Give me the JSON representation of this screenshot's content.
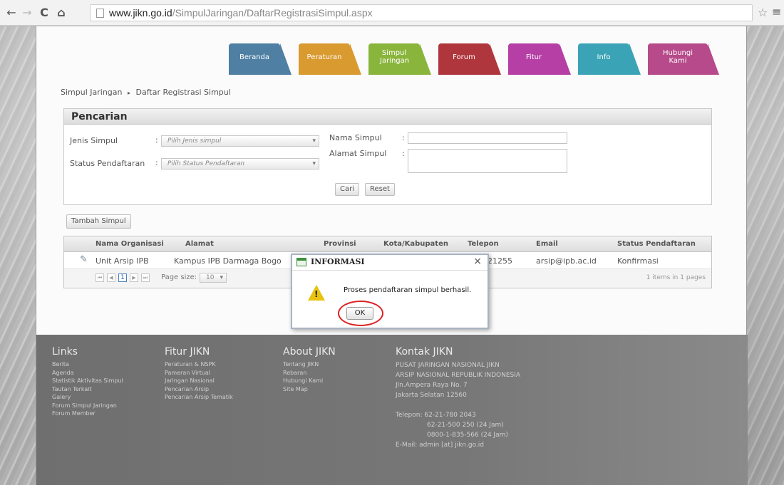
{
  "browser": {
    "url_host": "www.jikn.go.id",
    "url_path": "/SimpulJaringan/DaftarRegistrasiSimpul.aspx",
    "back_icon": "←",
    "forward_icon": "→",
    "reload_icon": "C",
    "home_icon": "⌂",
    "star_icon": "☆",
    "menu_icon": "≡"
  },
  "nav_tabs": [
    {
      "label": "Beranda",
      "color": "#4f7fa3"
    },
    {
      "label": "Peraturan",
      "color": "#d99a30"
    },
    {
      "label": "Simpul Jaringan",
      "color": "#8ab53c"
    },
    {
      "label": "Forum",
      "color": "#b0363d"
    },
    {
      "label": "Fitur",
      "color": "#b63fa6"
    },
    {
      "label": "Info",
      "color": "#3ba3b6"
    },
    {
      "label": "Hubungi Kami",
      "color": "#b64a8a"
    }
  ],
  "breadcrumb": {
    "root": "Simpul Jaringan",
    "separator": "▸",
    "current": "Daftar Registrasi Simpul"
  },
  "search": {
    "title": "Pencarian",
    "jenis_label": "Jenis Simpul",
    "jenis_value": "Pilih Jenis simpul",
    "status_label": "Status Pendaftaran",
    "status_value": "Pilih Status Pendaftaran",
    "nama_label": "Nama Simpul",
    "alamat_label": "Alamat Simpul",
    "cari_label": "Cari",
    "reset_label": "Reset",
    "colon": ":",
    "dropdown_icon": "▾"
  },
  "add_button": "Tambah Simpul",
  "grid": {
    "columns": [
      "Nama Organisasi",
      "Alamat",
      "Provinsi",
      "Kota/Kabupaten",
      "Telepon",
      "Email",
      "Status Pendaftaran"
    ],
    "rows": [
      {
        "organisasi": "Unit Arsip IPB",
        "alamat": "Kampus IPB Darmaga Bogo",
        "telepon": "21255",
        "email": "arsip@ipb.ac.id",
        "status": "Konfirmasi"
      }
    ],
    "edit_icon": "✎",
    "page_current": "1",
    "page_size_label": "Page size:",
    "page_size_value": "10",
    "items_info": "1 items in 1 pages",
    "pager_first": "⏮",
    "pager_prev": "◀",
    "pager_next": "▶",
    "pager_last": "⏭"
  },
  "footer": {
    "links_title": "Links",
    "links": [
      "Berita",
      "Agenda",
      "Statistik Aktivitas Simpul",
      "Tautan Terkait",
      "Galery",
      "Forum Simpul Jaringan",
      "Forum Member"
    ],
    "fitur_title": "Fitur JIKN",
    "fitur": [
      "Peraturan & NSPK",
      "Pameran Virtual",
      "Jaringan Nasional",
      "Pencarian Arsip",
      "Pencarian Arsip Tematik"
    ],
    "about_title": "About JIKN",
    "about": [
      "Tentang JIKN",
      "Rebaran",
      "Hubungi Kami",
      "Site Map"
    ],
    "kontak_title": "Kontak JIKN",
    "kontak": [
      "PUSAT JARINGAN NASIONAL JIKN",
      "ARSIP NASIONAL REPUBLIK INDONESIA",
      "Jln.Ampera Raya No. 7",
      "Jakarta Selatan 12560"
    ],
    "telepon": [
      "Telepon: 62-21-780 2043",
      "62-21-500 250   (24 Jam)",
      "0800-1-835-566 (24 Jam)"
    ],
    "email": "E-Mail:   admin [at] jikn.go.id"
  },
  "dialog": {
    "title": "INFORMASI",
    "close_icon": "×",
    "warning_mark": "!",
    "message": "Proses pendaftaran simpul berhasil.",
    "ok_label": "OK"
  }
}
